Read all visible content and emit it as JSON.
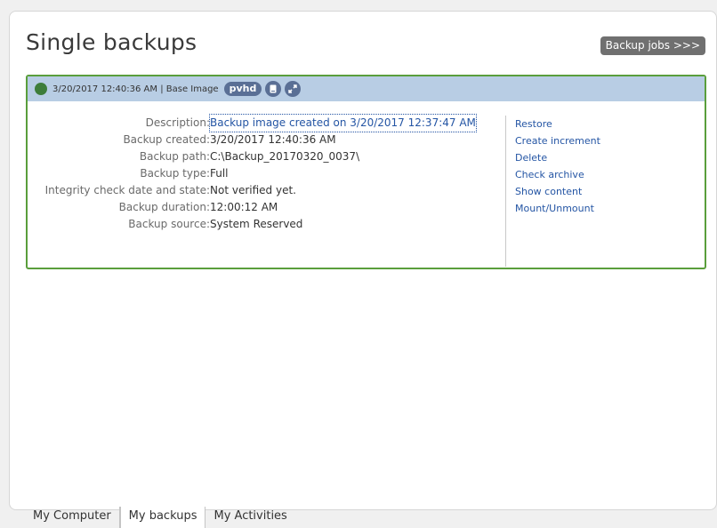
{
  "page": {
    "title": "Single backups",
    "jobs_button": "Backup jobs >>>"
  },
  "backup": {
    "header_text": "3/20/2017 12:40:36 AM | Base Image",
    "format_badge": "pvhd",
    "status_color": "#3e7d3a",
    "header_icons": [
      "disk-icon",
      "expand-icon"
    ],
    "fields": [
      {
        "label": "Description:",
        "value": "Backup image created on 3/20/2017 12:37:47 AM"
      },
      {
        "label": "Backup created:",
        "value": "3/20/2017 12:40:36 AM"
      },
      {
        "label": "Backup path:",
        "value": "C:\\Backup_20170320_0037\\"
      },
      {
        "label": "Backup type:",
        "value": "Full"
      },
      {
        "label": "Integrity check date and state:",
        "value": "Not verified yet."
      },
      {
        "label": "Backup duration:",
        "value": "12:00:12 AM"
      },
      {
        "label": "Backup source:",
        "value": "System Reserved"
      }
    ],
    "actions": [
      "Restore",
      "Create increment",
      "Delete",
      "Check archive",
      "Show content",
      "Mount/Unmount"
    ]
  },
  "tabs": [
    {
      "label": "My Computer"
    },
    {
      "label": "My backups",
      "active": true
    },
    {
      "label": "My Activities"
    }
  ],
  "colors": {
    "card_border": "#5a9e3c",
    "header_bg": "#b8cde4",
    "link": "#2455a4"
  }
}
